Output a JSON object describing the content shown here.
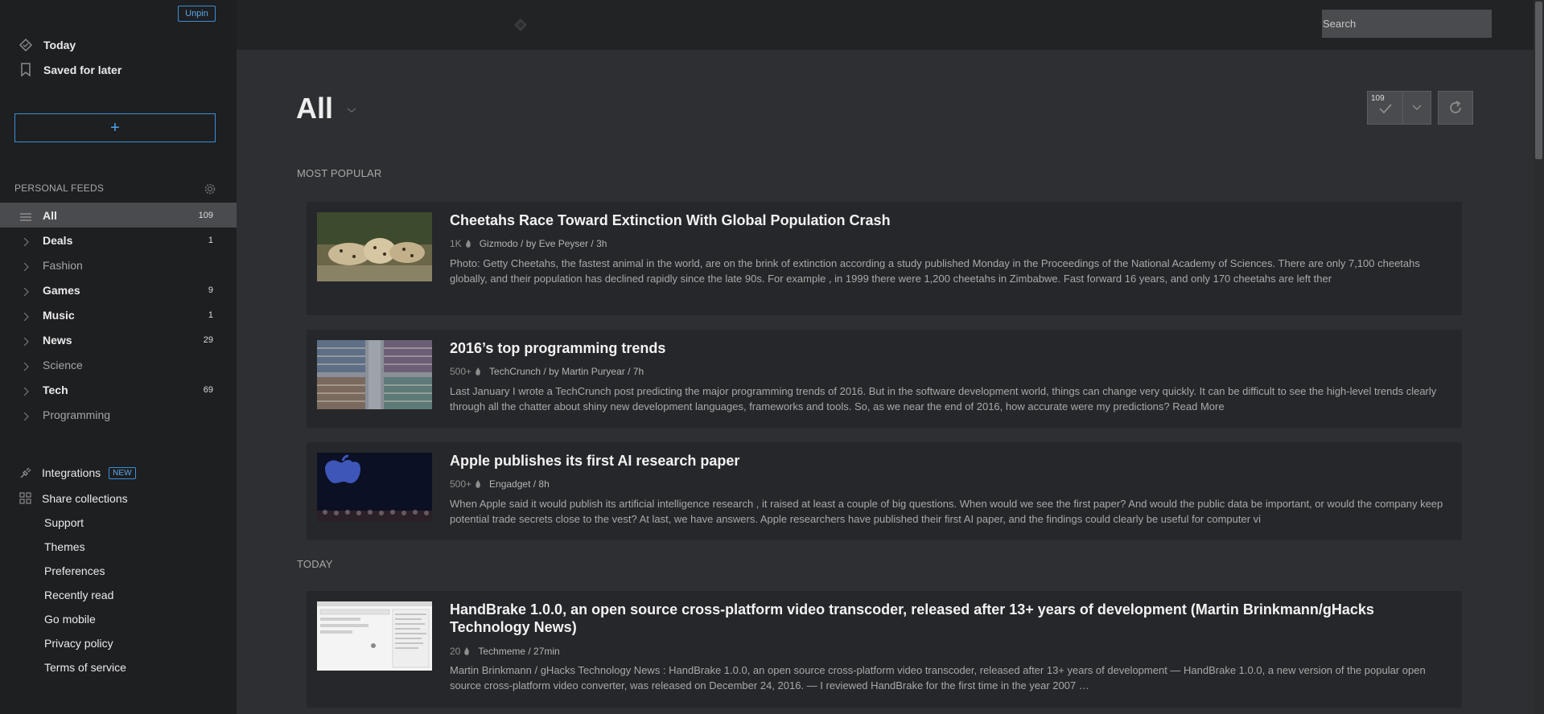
{
  "sidebar": {
    "unpin_label": "Unpin",
    "top_nav": [
      {
        "label": "Today",
        "icon": "today-icon"
      },
      {
        "label": "Saved for later",
        "icon": "bookmark-icon"
      }
    ],
    "add_label": "+",
    "feeds_header": "PERSONAL FEEDS",
    "feeds": [
      {
        "label": "All",
        "count": "109",
        "style": "active"
      },
      {
        "label": "Deals",
        "count": "1",
        "style": "bold"
      },
      {
        "label": "Fashion",
        "count": "",
        "style": "dim"
      },
      {
        "label": "Games",
        "count": "9",
        "style": "bold"
      },
      {
        "label": "Music",
        "count": "1",
        "style": "bold"
      },
      {
        "label": "News",
        "count": "29",
        "style": "bold"
      },
      {
        "label": "Science",
        "count": "",
        "style": "dim"
      },
      {
        "label": "Tech",
        "count": "69",
        "style": "bold"
      },
      {
        "label": "Programming",
        "count": "",
        "style": "dim"
      }
    ],
    "integrations_label": "Integrations",
    "new_badge": "NEW",
    "share_label": "Share collections",
    "links": [
      "Support",
      "Themes",
      "Preferences",
      "Recently read",
      "Go mobile",
      "Privacy policy",
      "Terms of service"
    ]
  },
  "topbar": {
    "search_placeholder": "Search"
  },
  "main": {
    "title": "All",
    "unread_count": "109",
    "sections": [
      {
        "label": "MOST POPULAR"
      },
      {
        "label": "TODAY"
      }
    ],
    "articles": [
      {
        "title": "Cheetahs Race Toward Extinction With Global Population Crash",
        "popularity": "1K",
        "source": "Gizmodo / by Eve Peyser / 3h",
        "summary": "Photo: Getty Cheetahs, the fastest animal in the world, are on the brink of extinction according a study published Monday in the Proceedings of the National Academy of Sciences. There are only 7,100 cheetahs globally, and their population has declined rapidly since the late 90s. For example , in 1999 there were 1,200 cheetahs in Zimbabwe. Fast forward 16 years, and only 170 cheetahs are left ther",
        "thumb": "cheetah-photo"
      },
      {
        "title": "2016’s top programming trends",
        "popularity": "500+",
        "source": "TechCrunch / by Martin Puryear / 7h",
        "summary": "Last January I wrote a TechCrunch post predicting the major programming trends of 2016. But in the software development world, things can change very quickly. It can be difficult to see the high-level trends clearly through all the chatter about shiny new development languages, frameworks and tools. So, as we near the end of 2016, how accurate were my predictions? Read More",
        "thumb": "bookshelf-photo"
      },
      {
        "title": "Apple publishes its first AI research paper",
        "popularity": "500+",
        "source": "Engadget / 8h",
        "summary": "When Apple said it would publish its artificial intelligence research , it raised at least a couple of big questions. When would we see the first paper? And would the public data be important, or would the company keep potential trade secrets close to the vest? At last, we have answers. Apple researchers have published their first AI paper, and the findings could clearly be useful for computer vi",
        "thumb": "apple-event-photo"
      },
      {
        "title": "HandBrake 1.0.0, an open source cross-platform video transcoder, released after 13+ years of development (Martin Brinkmann/gHacks Technology News)",
        "popularity": "20",
        "source": "Techmeme / 27min",
        "summary": "Martin Brinkmann / gHacks Technology News : HandBrake 1.0.0, an open source cross-platform video transcoder, released after 13+ years of development — HandBrake 1.0.0, a new version of the popular open source cross-platform video converter, was released on December 24, 2016. — I reviewed HandBrake for the first time in the year 2007 …",
        "thumb": "handbrake-screenshot"
      }
    ]
  }
}
